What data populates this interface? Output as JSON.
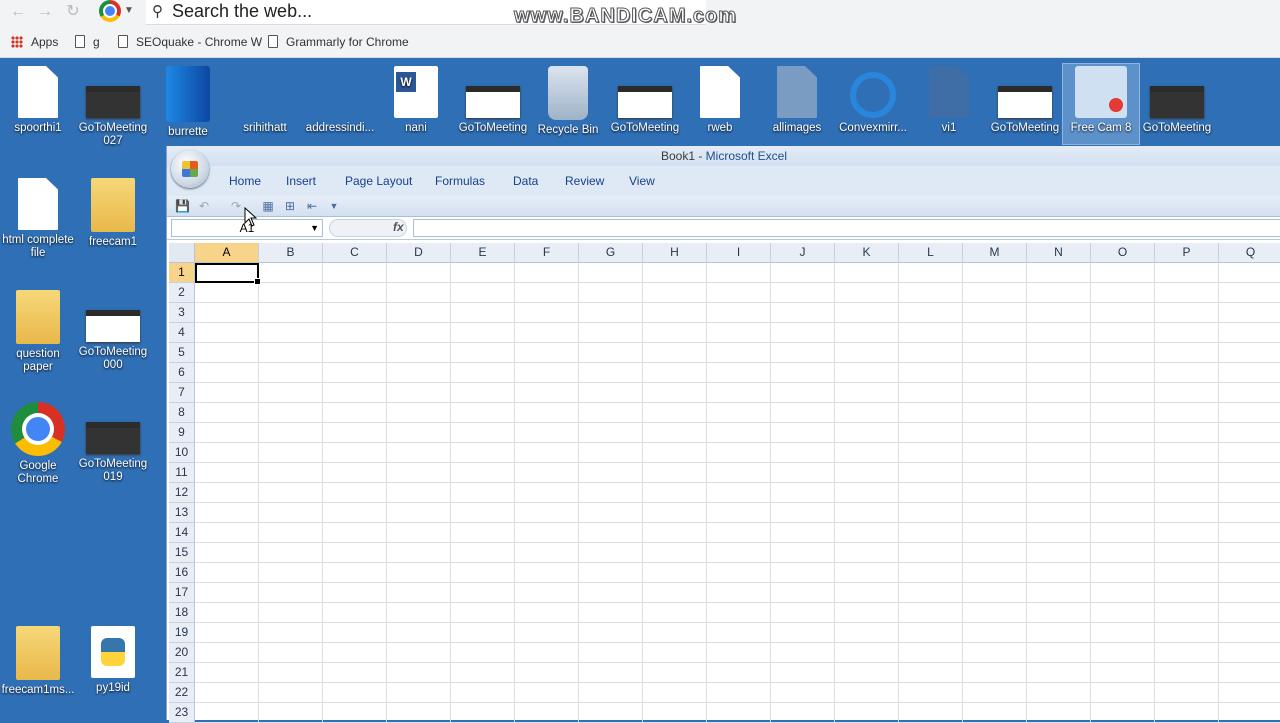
{
  "browser": {
    "search_placeholder": "Search the web...",
    "watermark": "www.BANDICAM.com",
    "bookmarks": [
      {
        "label": "Apps"
      },
      {
        "label": "g"
      },
      {
        "label": "SEOquake - Chrome W"
      },
      {
        "label": "Grammarly for Chrome"
      }
    ]
  },
  "desktop": {
    "icons": [
      {
        "label": "spoorthi1"
      },
      {
        "label": "GoToMeeting 027"
      },
      {
        "label": "burrette"
      },
      {
        "label": "srihithatt"
      },
      {
        "label": "addressindi..."
      },
      {
        "label": "nani"
      },
      {
        "label": "GoToMeeting"
      },
      {
        "label": "Recycle Bin"
      },
      {
        "label": "GoToMeeting"
      },
      {
        "label": "rweb"
      },
      {
        "label": "allimages"
      },
      {
        "label": "Convexmirr..."
      },
      {
        "label": "vi1"
      },
      {
        "label": "GoToMeeting"
      },
      {
        "label": "Free Cam 8"
      },
      {
        "label": "GoToMeeting"
      },
      {
        "label": "html complete file"
      },
      {
        "label": "freecam1"
      },
      {
        "label": "question paper"
      },
      {
        "label": "GoToMeeting 000"
      },
      {
        "label": "Google Chrome"
      },
      {
        "label": "GoToMeeting 019"
      },
      {
        "label": "freecam1ms..."
      },
      {
        "label": "py19id"
      }
    ]
  },
  "excel": {
    "title_doc": "Book1",
    "title_sep": " - ",
    "title_app": "Microsoft Excel",
    "tabs": [
      "Home",
      "Insert",
      "Page Layout",
      "Formulas",
      "Data",
      "Review",
      "View"
    ],
    "name_box": "A1",
    "fx_label": "fx",
    "columns": [
      "A",
      "B",
      "C",
      "D",
      "E",
      "F",
      "G",
      "H",
      "I",
      "J",
      "K",
      "L",
      "M",
      "N",
      "O",
      "P",
      "Q"
    ],
    "rows": [
      "1",
      "2",
      "3",
      "4",
      "5",
      "6",
      "7",
      "8",
      "9",
      "10",
      "11",
      "12",
      "13",
      "14",
      "15",
      "16",
      "17",
      "18",
      "19",
      "20",
      "21",
      "22",
      "23"
    ],
    "active_cell": "A1"
  }
}
